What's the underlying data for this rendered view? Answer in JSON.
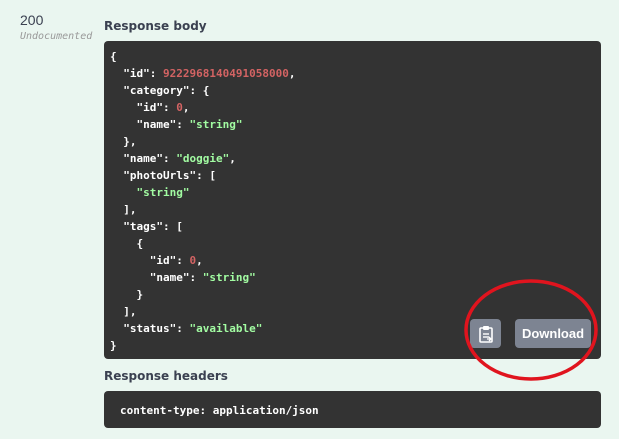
{
  "response": {
    "status_code": "200",
    "status_doc": "Undocumented"
  },
  "response_body": {
    "title": "Response body",
    "lines": [
      [
        {
          "t": "k",
          "v": "{"
        }
      ],
      [
        {
          "t": "k",
          "v": "  \"id\": "
        },
        {
          "t": "n",
          "v": "9222968140491058000"
        },
        {
          "t": "k",
          "v": ","
        }
      ],
      [
        {
          "t": "k",
          "v": "  \"category\": {"
        }
      ],
      [
        {
          "t": "k",
          "v": "    \"id\": "
        },
        {
          "t": "n",
          "v": "0"
        },
        {
          "t": "k",
          "v": ","
        }
      ],
      [
        {
          "t": "k",
          "v": "    \"name\": "
        },
        {
          "t": "s",
          "v": "\"string\""
        }
      ],
      [
        {
          "t": "k",
          "v": "  },"
        }
      ],
      [
        {
          "t": "k",
          "v": "  \"name\": "
        },
        {
          "t": "s",
          "v": "\"doggie\""
        },
        {
          "t": "k",
          "v": ","
        }
      ],
      [
        {
          "t": "k",
          "v": "  \"photoUrls\": ["
        }
      ],
      [
        {
          "t": "s",
          "v": "    \"string\""
        }
      ],
      [
        {
          "t": "k",
          "v": "  ],"
        }
      ],
      [
        {
          "t": "k",
          "v": "  \"tags\": ["
        }
      ],
      [
        {
          "t": "k",
          "v": "    {"
        }
      ],
      [
        {
          "t": "k",
          "v": "      \"id\": "
        },
        {
          "t": "n",
          "v": "0"
        },
        {
          "t": "k",
          "v": ","
        }
      ],
      [
        {
          "t": "k",
          "v": "      \"name\": "
        },
        {
          "t": "s",
          "v": "\"string\""
        }
      ],
      [
        {
          "t": "k",
          "v": "    }"
        }
      ],
      [
        {
          "t": "k",
          "v": "  ],"
        }
      ],
      [
        {
          "t": "k",
          "v": "  \"status\": "
        },
        {
          "t": "s",
          "v": "\"available\""
        }
      ],
      [
        {
          "t": "k",
          "v": "}"
        }
      ]
    ],
    "copy_icon": "clipboard-icon",
    "download_label": "Download"
  },
  "response_headers": {
    "title": "Response headers",
    "content": "content-type: application/json"
  },
  "colors": {
    "background": "#eaf6f0",
    "code_background": "#333333",
    "string": "#a2fca2",
    "number": "#d36363",
    "button": "#7d8492",
    "annotation": "#e0141e"
  }
}
